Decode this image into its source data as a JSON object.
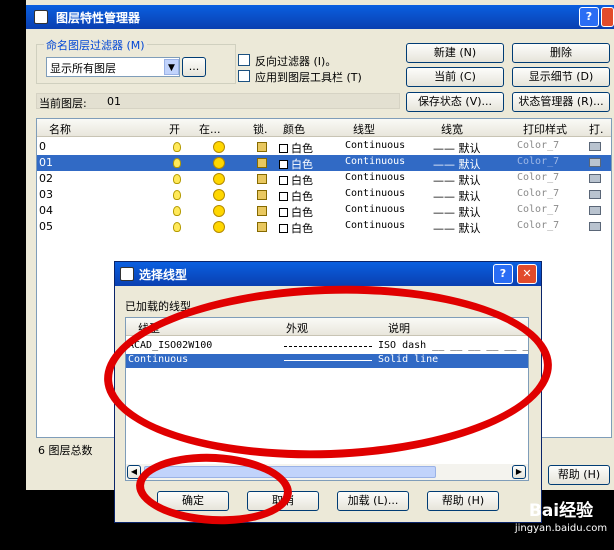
{
  "main": {
    "title": "图层特性管理器",
    "filter_group": "命名图层过滤器 (M)",
    "filter_value": "显示所有图层",
    "browse": "...",
    "invert": "反向过滤器 (I)。",
    "apply_toolbar": "应用到图层工具栏 (T)",
    "buttons": {
      "new": "新建 (N)",
      "delete": "删除",
      "current": "当前 (C)",
      "details": "显示细节 (D)",
      "save_state": "保存状态 (V)...",
      "state_manager": "状态管理器 (R)..."
    },
    "current_layer_label": "当前图层:",
    "current_layer_value": "01",
    "columns": [
      "名称",
      "开",
      "在...",
      "锁.",
      "颜色",
      "线型",
      "线宽",
      "打印样式",
      "打."
    ],
    "layers": [
      {
        "name": "0",
        "color": "白色",
        "linetype": "Continuous",
        "lineweight": "—— 默认",
        "plotstyle": "Color_7"
      },
      {
        "name": "01",
        "color": "白色",
        "linetype": "Continuous",
        "lineweight": "—— 默认",
        "plotstyle": "Color_7"
      },
      {
        "name": "02",
        "color": "白色",
        "linetype": "Continuous",
        "lineweight": "—— 默认",
        "plotstyle": "Color_7"
      },
      {
        "name": "03",
        "color": "白色",
        "linetype": "Continuous",
        "lineweight": "—— 默认",
        "plotstyle": "Color_7"
      },
      {
        "name": "04",
        "color": "白色",
        "linetype": "Continuous",
        "lineweight": "—— 默认",
        "plotstyle": "Color_7"
      },
      {
        "name": "05",
        "color": "白色",
        "linetype": "Continuous",
        "lineweight": "—— 默认",
        "plotstyle": "Color_7"
      }
    ],
    "layer_count": "6  图层总数",
    "help": "帮助 (H)"
  },
  "dialog": {
    "title": "选择线型",
    "loaded_label": "已加载的线型",
    "columns": [
      "线型",
      "外观",
      "说明"
    ],
    "rows": [
      {
        "name": "ACAD_ISO02W100",
        "desc": "ISO dash __ __ __ __ __ __"
      },
      {
        "name": "Continuous",
        "desc": "Solid line"
      }
    ],
    "buttons": {
      "ok": "确定",
      "cancel": "取消",
      "load": "加载 (L)...",
      "help": "帮助 (H)"
    }
  },
  "watermark": {
    "brand": "Bai经验",
    "url": "jingyan.baidu.com"
  }
}
